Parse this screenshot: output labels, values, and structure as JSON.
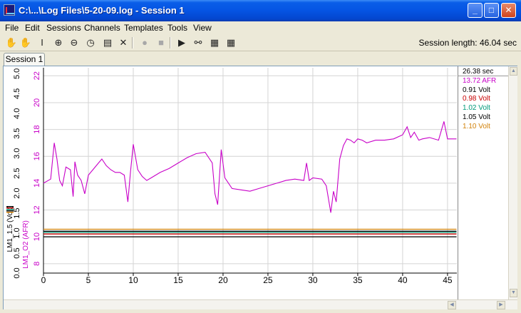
{
  "window": {
    "title": "C:\\...\\Log Files\\5-20-09.log - Session 1"
  },
  "window_buttons": {
    "minimize": "_",
    "maximize": "□",
    "close": "✕"
  },
  "menu": [
    "File",
    "Edit",
    "Sessions",
    "Channels",
    "Templates",
    "Tools",
    "View"
  ],
  "toolbar": {
    "tools": [
      {
        "name": "hand-icon",
        "glyph": "✋",
        "enabled": true
      },
      {
        "name": "pan-icon",
        "glyph": "✋",
        "enabled": false
      },
      {
        "name": "cursor-icon",
        "glyph": "I",
        "enabled": true
      },
      {
        "name": "zoom-in-icon",
        "glyph": "⊕",
        "enabled": true
      },
      {
        "name": "zoom-out-icon",
        "glyph": "⊖",
        "enabled": true
      },
      {
        "name": "gauge-icon",
        "glyph": "◷",
        "enabled": true
      },
      {
        "name": "notes-icon",
        "glyph": "▤",
        "enabled": true
      },
      {
        "name": "disconnect-icon",
        "glyph": "✕",
        "enabled": true
      },
      {
        "name": "record-icon",
        "glyph": "●",
        "enabled": false
      },
      {
        "name": "stop-icon",
        "glyph": "■",
        "enabled": false
      },
      {
        "name": "play-icon",
        "glyph": "▶",
        "enabled": true
      },
      {
        "name": "binoculars-icon",
        "glyph": "⚯",
        "enabled": true
      },
      {
        "name": "chart-view-icon",
        "glyph": "▦",
        "enabled": true
      },
      {
        "name": "table-view-icon",
        "glyph": "▦",
        "enabled": true
      }
    ],
    "session_length_label": "Session length:",
    "session_length_value": "46.04 sec"
  },
  "tabs": [
    "Session 1"
  ],
  "colors": {
    "afr": "#c800c8",
    "grid": "#d4d4d4",
    "line_black": "#000000",
    "line_red": "#c80000",
    "line_teal": "#009a7a",
    "line_gray": "#666666",
    "line_orange": "#d2820a"
  },
  "legend": {
    "time": "26.38 sec",
    "entries": [
      {
        "text": "13.72 AFR",
        "color": "#c800c8"
      },
      {
        "text": "0.91 Volt",
        "color": "#000000"
      },
      {
        "text": "0.98 Volt",
        "color": "#c80000"
      },
      {
        "text": "1.02 Volt",
        "color": "#009a7a"
      },
      {
        "text": "1.05 Volt",
        "color": "#000000"
      },
      {
        "text": "1.10 Volt",
        "color": "#d2820a"
      }
    ]
  },
  "chart_data": {
    "type": "line",
    "xlim": [
      0,
      46.04
    ],
    "x_ticks": [
      "0",
      "5",
      "10",
      "15",
      "20",
      "25",
      "30",
      "35",
      "40",
      "45"
    ],
    "x_tick_values": [
      0,
      5,
      10,
      15,
      20,
      25,
      30,
      35,
      40,
      45
    ],
    "axes": {
      "afr": {
        "label": "LM1_O2 (AFR)",
        "ylim": [
          7.3,
          22.6
        ],
        "ticks": [
          "8",
          "10",
          "12",
          "14",
          "16",
          "18",
          "20",
          "22"
        ],
        "tick_values": [
          8,
          10,
          12,
          14,
          16,
          18,
          20,
          22
        ]
      },
      "volt": {
        "label": "LM1_1.5 (Volt)",
        "ylim": [
          0,
          5.15
        ],
        "ticks": [
          "0.0",
          "0.5",
          "1.0",
          "1.5",
          "2.0",
          "2.5",
          "3.0",
          "3.5",
          "4.0",
          "4.5",
          "5.0"
        ],
        "tick_values": [
          0,
          0.5,
          1.0,
          1.5,
          2.0,
          2.5,
          3.0,
          3.5,
          4.0,
          4.5,
          5.0
        ]
      }
    },
    "grid": true,
    "series": [
      {
        "axis": "afr",
        "color": "#c800c8",
        "x": [
          0.0,
          0.8,
          1.2,
          1.5,
          1.8,
          2.1,
          2.5,
          3.0,
          3.3,
          3.5,
          3.8,
          4.2,
          4.6,
          5.0,
          5.5,
          6.0,
          6.5,
          7.0,
          7.5,
          8.0,
          8.5,
          9.0,
          9.4,
          9.7,
          10.0,
          10.5,
          11.0,
          11.5,
          12.0,
          13.0,
          14.0,
          15.0,
          16.0,
          17.0,
          18.0,
          18.8,
          19.1,
          19.4,
          19.8,
          20.2,
          21.0,
          22.0,
          23.0,
          24.0,
          25.0,
          26.0,
          27.0,
          28.0,
          29.0,
          29.3,
          29.6,
          30.0,
          31.0,
          31.5,
          31.8,
          32.0,
          32.3,
          32.6,
          33.0,
          33.4,
          33.8,
          34.2,
          34.6,
          35.0,
          35.5,
          36.0,
          37.0,
          38.0,
          39.0,
          40.0,
          40.5,
          40.9,
          41.3,
          41.8,
          42.2,
          43.0,
          44.0,
          44.6,
          45.0,
          46.0
        ],
        "y": [
          14.0,
          14.3,
          17.0,
          15.8,
          14.2,
          13.8,
          15.2,
          15.0,
          13.0,
          15.6,
          14.6,
          14.2,
          13.2,
          14.6,
          15.0,
          15.4,
          15.8,
          15.3,
          15.0,
          14.8,
          14.8,
          14.6,
          12.6,
          14.9,
          16.9,
          15.0,
          14.5,
          14.2,
          14.4,
          14.8,
          15.1,
          15.5,
          15.9,
          16.2,
          16.3,
          15.5,
          13.2,
          12.4,
          16.5,
          14.4,
          13.6,
          13.5,
          13.4,
          13.6,
          13.8,
          14.0,
          14.2,
          14.3,
          14.2,
          15.5,
          14.2,
          14.4,
          14.3,
          13.8,
          12.6,
          11.8,
          13.4,
          12.6,
          15.8,
          16.8,
          17.3,
          17.2,
          17.0,
          17.3,
          17.2,
          17.0,
          17.2,
          17.2,
          17.3,
          17.6,
          18.2,
          17.4,
          17.8,
          17.2,
          17.3,
          17.4,
          17.2,
          18.6,
          17.3,
          17.3
        ]
      },
      {
        "axis": "volt",
        "color": "#d2820a",
        "x": [
          0,
          46
        ],
        "y": [
          1.1,
          1.1
        ]
      },
      {
        "axis": "volt",
        "color": "#000000",
        "x": [
          0,
          46
        ],
        "y": [
          1.05,
          1.05
        ]
      },
      {
        "axis": "volt",
        "color": "#009a7a",
        "x": [
          0,
          46
        ],
        "y": [
          1.02,
          1.02
        ]
      },
      {
        "axis": "volt",
        "color": "#c80000",
        "x": [
          0,
          46
        ],
        "y": [
          0.98,
          0.98
        ]
      },
      {
        "axis": "volt",
        "color": "#000000",
        "x": [
          0,
          46
        ],
        "y": [
          0.91,
          0.91
        ]
      }
    ]
  }
}
